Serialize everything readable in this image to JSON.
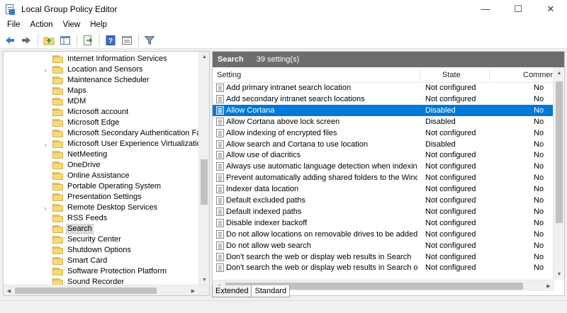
{
  "window": {
    "title": "Local Group Policy Editor",
    "minimize_glyph": "—",
    "maximize_glyph": "☐",
    "close_glyph": "✕"
  },
  "menu": {
    "items": [
      "File",
      "Action",
      "View",
      "Help"
    ]
  },
  "toolbar": {
    "icons": [
      "back-arrow-icon",
      "forward-arrow-icon",
      "up-folder-icon",
      "show-hide-tree-icon",
      "export-list-icon",
      "help-icon",
      "properties-icon",
      "filter-icon"
    ]
  },
  "tree": {
    "items": [
      {
        "label": "Internet Information Services",
        "expandable": false
      },
      {
        "label": "Location and Sensors",
        "expandable": true
      },
      {
        "label": "Maintenance Scheduler",
        "expandable": false
      },
      {
        "label": "Maps",
        "expandable": false
      },
      {
        "label": "MDM",
        "expandable": false
      },
      {
        "label": "Microsoft account",
        "expandable": false
      },
      {
        "label": "Microsoft Edge",
        "expandable": false
      },
      {
        "label": "Microsoft Secondary Authentication Factor",
        "expandable": false
      },
      {
        "label": "Microsoft User Experience Virtualization",
        "expandable": true
      },
      {
        "label": "NetMeeting",
        "expandable": false
      },
      {
        "label": "OneDrive",
        "expandable": false
      },
      {
        "label": "Online Assistance",
        "expandable": false
      },
      {
        "label": "Portable Operating System",
        "expandable": false
      },
      {
        "label": "Presentation Settings",
        "expandable": false
      },
      {
        "label": "Remote Desktop Services",
        "expandable": true
      },
      {
        "label": "RSS Feeds",
        "expandable": false
      },
      {
        "label": "Search",
        "expandable": false,
        "selected": true
      },
      {
        "label": "Security Center",
        "expandable": false
      },
      {
        "label": "Shutdown Options",
        "expandable": false
      },
      {
        "label": "Smart Card",
        "expandable": false
      },
      {
        "label": "Software Protection Platform",
        "expandable": false
      },
      {
        "label": "Sound Recorder",
        "expandable": false
      }
    ]
  },
  "details": {
    "header_title": "Search",
    "header_count": "39 setting(s)",
    "columns": {
      "setting": "Setting",
      "state": "State",
      "comment": "Comment"
    },
    "rows": [
      {
        "setting": "Add primary intranet search location",
        "state": "Not configured",
        "comment": "No"
      },
      {
        "setting": "Add secondary intranet search locations",
        "state": "Not configured",
        "comment": "No"
      },
      {
        "setting": "Allow Cortana",
        "state": "Disabled",
        "comment": "No",
        "selected": true
      },
      {
        "setting": "Allow Cortana above lock screen",
        "state": "Disabled",
        "comment": "No"
      },
      {
        "setting": "Allow indexing of encrypted files",
        "state": "Not configured",
        "comment": "No"
      },
      {
        "setting": "Allow search and Cortana to use location",
        "state": "Disabled",
        "comment": "No"
      },
      {
        "setting": "Allow use of diacritics",
        "state": "Not configured",
        "comment": "No"
      },
      {
        "setting": "Always use automatic language detection when indexing con...",
        "state": "Not configured",
        "comment": "No"
      },
      {
        "setting": "Prevent automatically adding shared folders to the Windows ...",
        "state": "Not configured",
        "comment": "No"
      },
      {
        "setting": "Indexer data location",
        "state": "Not configured",
        "comment": "No"
      },
      {
        "setting": "Default excluded paths",
        "state": "Not configured",
        "comment": "No"
      },
      {
        "setting": "Default indexed paths",
        "state": "Not configured",
        "comment": "No"
      },
      {
        "setting": "Disable indexer backoff",
        "state": "Not configured",
        "comment": "No"
      },
      {
        "setting": "Do not allow locations on removable drives to be added to li...",
        "state": "Not configured",
        "comment": "No"
      },
      {
        "setting": "Do not allow web search",
        "state": "Not configured",
        "comment": "No"
      },
      {
        "setting": "Don't search the web or display web results in Search",
        "state": "Not configured",
        "comment": "No"
      },
      {
        "setting": "Don't search the web or display web results in Search over m...",
        "state": "Not configured",
        "comment": "No"
      }
    ]
  },
  "tabs": [
    {
      "label": "Extended",
      "active": false
    },
    {
      "label": "Standard",
      "active": true
    }
  ]
}
